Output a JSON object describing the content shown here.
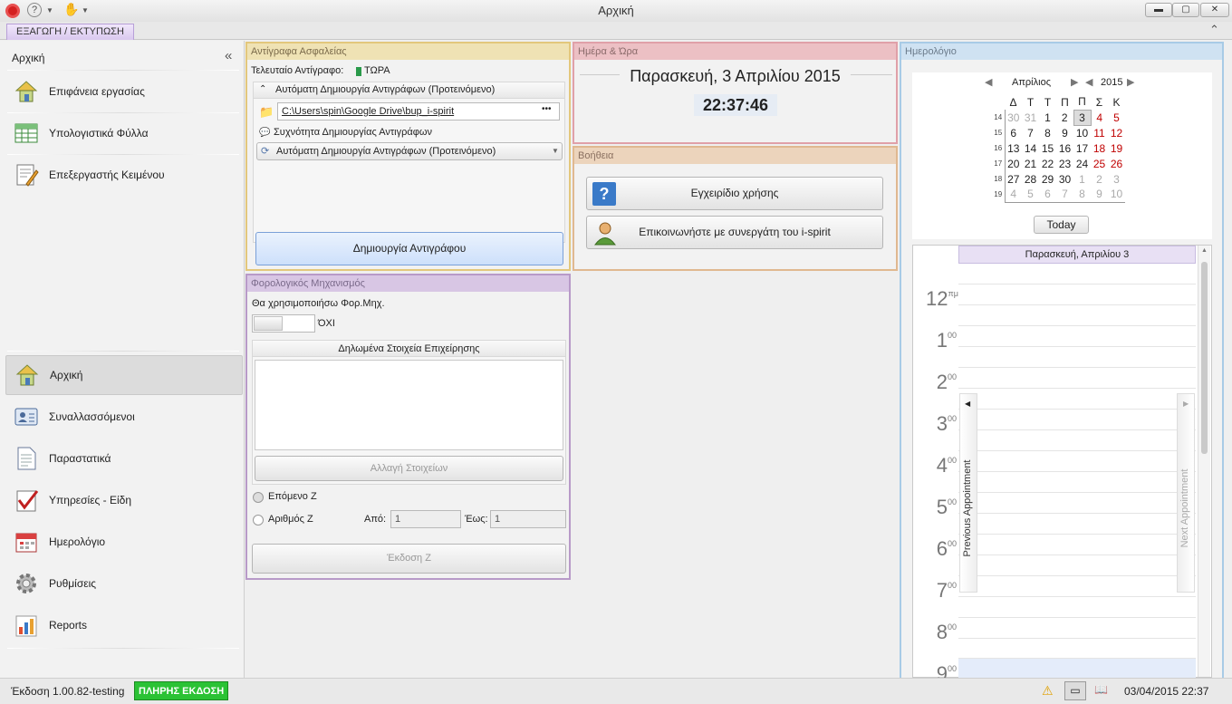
{
  "window": {
    "title": "Αρχική",
    "minimize": "▬",
    "maximize": "▢",
    "close": "✕"
  },
  "ribbon": {
    "tab": "ΕΞΑΓΩΓΗ / ΕΚΤΥΠΩΣΗ",
    "collapse": "⌃"
  },
  "nav": {
    "header": "Αρχική",
    "collapse": "«",
    "top_items": [
      {
        "label": "Επιφάνεια εργασίας",
        "icon": "desktop-icon"
      },
      {
        "label": "Υπολογιστικά Φύλλα",
        "icon": "spreadsheet-icon"
      },
      {
        "label": "Επεξεργαστής Κειμένου",
        "icon": "text-editor-icon"
      }
    ],
    "items": [
      {
        "label": "Αρχική",
        "icon": "home-icon"
      },
      {
        "label": "Συναλλασσόμενοι",
        "icon": "contacts-icon"
      },
      {
        "label": "Παραστατικά",
        "icon": "document-icon"
      },
      {
        "label": "Υπηρεσίες - Είδη",
        "icon": "checklist-icon"
      },
      {
        "label": "Ημερολόγιο",
        "icon": "calendar-icon"
      },
      {
        "label": "Ρυθμίσεις",
        "icon": "gear-icon"
      },
      {
        "label": "Reports",
        "icon": "reports-icon"
      }
    ]
  },
  "backup": {
    "title": "Αντίγραφα Ασφαλείας",
    "last_label": "Τελευταίο Αντίγραφο:",
    "last_value": "ΤΩΡΑ",
    "group_title": "Αυτόματη Δημιουργία Αντιγράφων (Προτεινόμενο)",
    "path": "C:\\Users\\spin\\Google Drive\\bup_i-spirit",
    "path_button": "•••",
    "freq_label": "Συχνότητα Δημιουργίας Αντιγράφων",
    "freq_value": "Αυτόματη Δημιουργία Αντιγράφων (Προτεινόμενο)",
    "create_button": "Δημιουργία Αντιγράφου"
  },
  "datetime": {
    "title": "Ημέρα & Ώρα",
    "date": "Παρασκευή, 3 Απριλίου 2015",
    "time": "22:37:46"
  },
  "help": {
    "title": "Βοήθεια",
    "manual": "Εγχειρίδιο χρήσης",
    "contact": "Επικοινωνήστε με συνεργάτη του i-spirit"
  },
  "fiscal": {
    "title": "Φορολογικός Μηχανισμός",
    "use_label": "Θα χρησιμοποιήσω Φορ.Μηχ.",
    "toggle_value": "ΌΧΙ",
    "group_title": "Δηλωμένα Στοιχεία Επιχείρησης",
    "change_button": "Αλλαγή Στοιχείων",
    "next_z": "Επόμενο Ζ",
    "number_z": "Αριθμός Ζ",
    "from_label": "Από:",
    "from_value": "1",
    "to_label": "Έως:",
    "to_value": "1",
    "issue_button": "Έκδοση Ζ"
  },
  "calendar": {
    "title": "Ημερολόγιο",
    "month": "Απρίλιος",
    "year": "2015",
    "weekdays": [
      "Δ",
      "Τ",
      "Τ",
      "Π",
      "Π",
      "Σ",
      "Κ"
    ],
    "weeks": [
      {
        "wk": "14",
        "days": [
          "30",
          "31",
          "1",
          "2",
          "3",
          "4",
          "5"
        ]
      },
      {
        "wk": "15",
        "days": [
          "6",
          "7",
          "8",
          "9",
          "10",
          "11",
          "12"
        ]
      },
      {
        "wk": "16",
        "days": [
          "13",
          "14",
          "15",
          "16",
          "17",
          "18",
          "19"
        ]
      },
      {
        "wk": "17",
        "days": [
          "20",
          "21",
          "22",
          "23",
          "24",
          "25",
          "26"
        ]
      },
      {
        "wk": "18",
        "days": [
          "27",
          "28",
          "29",
          "30",
          "1",
          "2",
          "3"
        ]
      },
      {
        "wk": "19",
        "days": [
          "4",
          "5",
          "6",
          "7",
          "8",
          "9",
          "10"
        ]
      }
    ],
    "today_button": "Today",
    "day_header": "Παρασκευή, Απριλίου 3",
    "prev_appt": "Previous Appointment",
    "next_appt": "Next Appointment",
    "hours": [
      {
        "h": "12",
        "m": "πμ"
      },
      {
        "h": "1",
        "m": "00"
      },
      {
        "h": "2",
        "m": "00"
      },
      {
        "h": "3",
        "m": "00"
      },
      {
        "h": "4",
        "m": "00"
      },
      {
        "h": "5",
        "m": "00"
      },
      {
        "h": "6",
        "m": "00"
      },
      {
        "h": "7",
        "m": "00"
      },
      {
        "h": "8",
        "m": "00"
      },
      {
        "h": "9",
        "m": "00"
      }
    ]
  },
  "status": {
    "version": "Έκδοση 1.00.82-testing",
    "edition": "ΠΛΗΡΗΣ ΕΚΔΟΣΗ",
    "datetime": "03/04/2015 22:37"
  },
  "colors": {
    "backup": "#e3c77c",
    "datetime": "#e0a0a8",
    "help": "#e0b890",
    "fiscal": "#b89ac8",
    "calendar": "#a8cbe6",
    "edition": "#2bc235"
  }
}
